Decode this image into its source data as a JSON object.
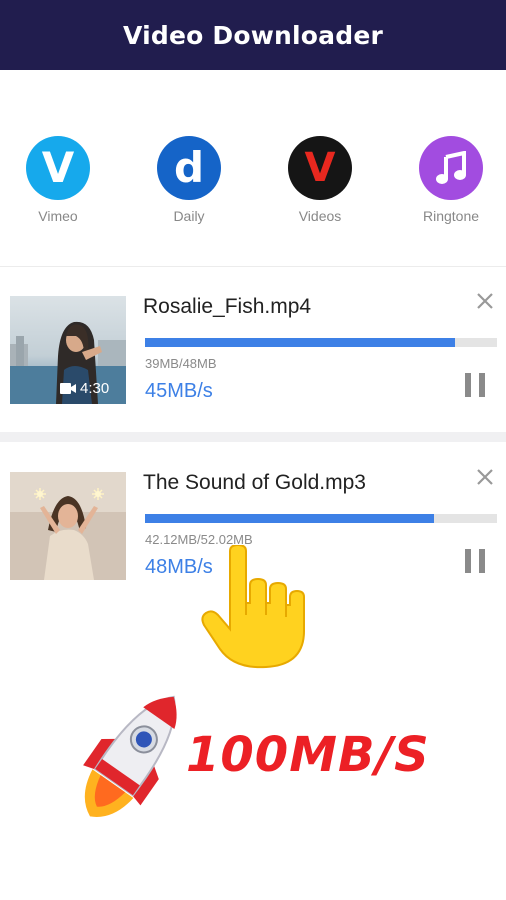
{
  "header": {
    "title": "Video Downloader"
  },
  "shortcuts": [
    {
      "letter": "V",
      "label": "Vimeo",
      "icon": "vimeo-icon",
      "color": "#16a9ec"
    },
    {
      "letter": "d",
      "label": "Daily",
      "icon": "dailymotion-icon",
      "color": "#1564c8"
    },
    {
      "letter": "V",
      "label": "Videos",
      "icon": "videos-icon",
      "color": "#151515"
    },
    {
      "label": "Ringtone",
      "icon": "music-note-icon",
      "color": "#a24ce0"
    }
  ],
  "downloads": [
    {
      "title": "Rosalie_Fish.mp4",
      "size": "39MB/48MB",
      "speed": "45MB/s",
      "progress": 0.88,
      "duration": "4:30",
      "thumbnail": "woman-by-waterfront",
      "icons": [
        "video-camera-icon",
        "close-icon",
        "pause-icon"
      ]
    },
    {
      "title": "The Sound of Gold.mp3",
      "size": "42.12MB/52.02MB",
      "speed": "48MB/s",
      "progress": 0.82,
      "thumbnail": "woman-with-sparklers",
      "icons": [
        "close-icon",
        "pause-icon"
      ]
    }
  ],
  "promo": {
    "text": "100MB/S",
    "icons": [
      "rocket-icon",
      "pointing-hand-icon"
    ]
  },
  "colors": {
    "header": "#211d4e",
    "accent": "#3d80e6",
    "promo": "#ec2025"
  }
}
